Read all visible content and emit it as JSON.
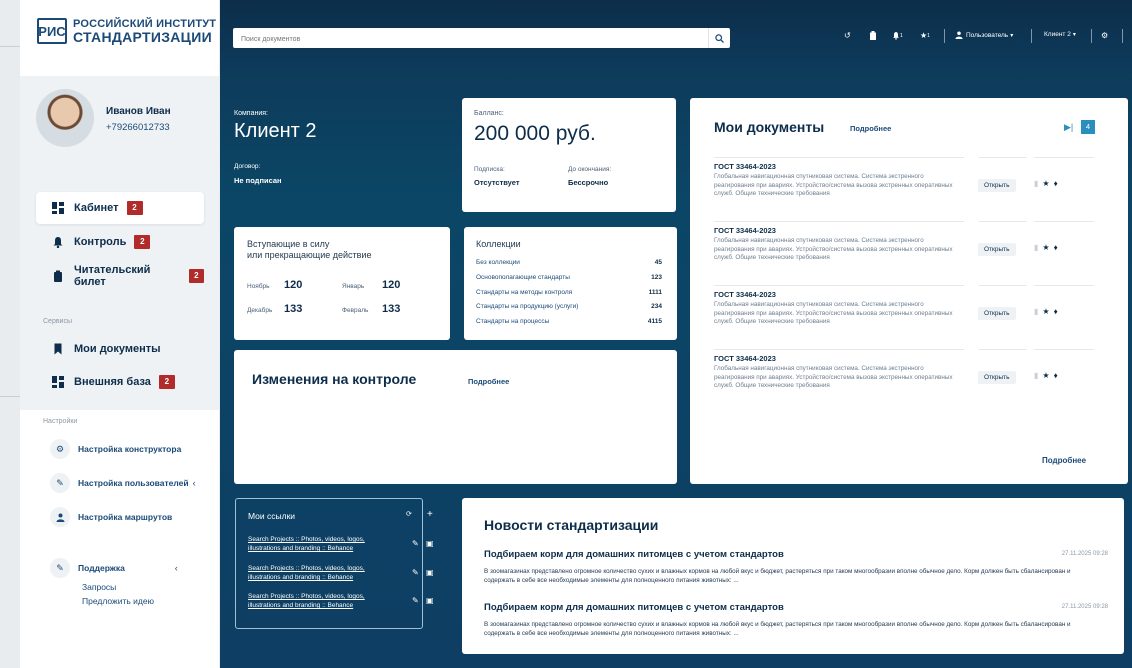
{
  "logo": {
    "mark": "РИС",
    "line1": "РОССИЙСКИЙ ИНСТИТУТ",
    "line2": "СТАНДАРТИЗАЦИИ"
  },
  "profile": {
    "name": "Иванов Иван",
    "phone": "+79266012733"
  },
  "menu": [
    {
      "label": "Кабинет",
      "badge": "2",
      "icon": "grid-icon"
    },
    {
      "label": "Контроль",
      "badge": "2",
      "icon": "bell-icon"
    },
    {
      "label": "Читательский билет",
      "badge": "2",
      "icon": "clipboard-icon"
    }
  ],
  "services": {
    "label": "Сервисы",
    "items": [
      {
        "label": "Мои документы",
        "icon": "bookmark-icon"
      },
      {
        "label": "Внешняя база",
        "badge": "2",
        "icon": "grid-icon"
      }
    ]
  },
  "settings": {
    "label": "Настройки",
    "items": [
      {
        "label": "Настройка конструктора",
        "icon": "gear-icon"
      },
      {
        "label": "Настройка пользователей",
        "icon": "edit-icon"
      },
      {
        "label": "Настройка маршрутов",
        "icon": "user-icon"
      }
    ],
    "support": {
      "label": "Поддержка",
      "links": [
        "Запросы",
        "Предложить идею"
      ]
    }
  },
  "topbar": {
    "search_placeholder": "Поиск документов",
    "bell_count": "1",
    "star_count": "1",
    "user_label": "Пользователь",
    "client_label": "Клиент 2"
  },
  "company": {
    "label": "Компания:",
    "value": "Клиент 2",
    "contract_label": "Договор:",
    "contract_value": "Не подписан"
  },
  "balance": {
    "label": "Балланс:",
    "value": "200 000 руб.",
    "sub_label": "Подписка:",
    "sub_value": "Отсутствует",
    "end_label": "До окончания:",
    "end_value": "Бессрочно"
  },
  "effect": {
    "title1": "Вступающие в силу",
    "title2": "или прекращающие действие",
    "items": [
      {
        "label": "Ноябрь",
        "value": "120"
      },
      {
        "label": "Январь",
        "value": "120"
      },
      {
        "label": "Декабрь",
        "value": "133"
      },
      {
        "label": "Февраль",
        "value": "133"
      }
    ]
  },
  "collections": {
    "title": "Коллекции",
    "rows": [
      {
        "label": "Без коллекции",
        "value": "45"
      },
      {
        "label": "Основополагающие стандарты",
        "value": "123"
      },
      {
        "label": "Стандарты на методы контроля",
        "value": "1111"
      },
      {
        "label": "Стандарты на продукцию (услуги)",
        "value": "234"
      },
      {
        "label": "Стандарты на процессы",
        "value": "4115"
      }
    ]
  },
  "changes": {
    "title": "Изменения на контроле",
    "more": "Подробнее"
  },
  "mydocs": {
    "title": "Мои документы",
    "more": "Подробнее",
    "count": "4",
    "footer_more": "Подробнее",
    "open_label": "Открыть",
    "items": [
      {
        "code": "ГОСТ 33464-2023",
        "desc": "Глобальная навигационная спутниковая система. Система экстренного реагирования при авариях. Устройство/система вызова экстренных оперативных служб. Общие технические требования"
      },
      {
        "code": "ГОСТ 33464-2023",
        "desc": "Глобальная навигационная спутниковая система. Система экстренного реагирования при авариях. Устройство/система вызова экстренных оперативных служб. Общие технические требования"
      },
      {
        "code": "ГОСТ 33464-2023",
        "desc": "Глобальная навигационная спутниковая система. Система экстренного реагирования при авариях. Устройство/система вызова экстренных оперативных служб. Общие технические требования"
      },
      {
        "code": "ГОСТ 33464-2023",
        "desc": "Глобальная навигационная спутниковая система. Система экстренного реагирования при авариях. Устройство/система вызова экстренных оперативных служб. Общие технические требования"
      }
    ]
  },
  "links": {
    "title": "Мои ссылки",
    "items": [
      "Search Projects :: Photos, videos, logos, illustrations and branding :: Behance",
      "Search Projects :: Photos, videos, logos, illustrations and branding :: Behance",
      "Search Projects :: Photos, videos, logos, illustrations and branding :: Behance"
    ]
  },
  "news": {
    "title": "Новости стандартизации",
    "items": [
      {
        "title": "Подбираем корм для домашних питомцев с учетом стандартов",
        "date": "27.11.2025 09:28",
        "text": "В зоомагазинах представлено огромное количество сухих и влажных кормов на любой вкус и бюджет, растеряться при таком многообразии вполне обычное дело. Корм должен быть сбалансирован и содержать в себе все необходимые элементы для полноценного питания животных: ..."
      },
      {
        "title": "Подбираем корм для домашних питомцев с учетом стандартов",
        "date": "27.11.2025 09:28",
        "text": "В зоомагазинах представлено огромное количество сухих и влажных кормов на любой вкус и бюджет, растеряться при таком многообразии вполне обычное дело. Корм должен быть сбалансирован и содержать в себе все необходимые элементы для полноценного питания животных: ..."
      }
    ]
  },
  "colors": {
    "navy": "#0d2d4a",
    "accent": "#1c4a78",
    "badge": "#b22b2b",
    "teal": "#2a8fbf"
  }
}
